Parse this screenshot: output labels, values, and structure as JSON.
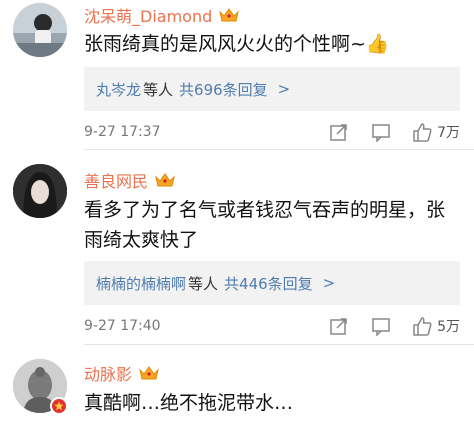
{
  "comments": [
    {
      "username": "沈呆萌_Diamond",
      "text": "张雨绮真的是风风火火的个性啊~👍",
      "reply_names": "丸岑龙",
      "reply_suffix": "等人",
      "reply_count": "共696条回复",
      "reply_arrow": ">",
      "time": "9-27 17:37",
      "likes": "7万",
      "avatar_icon": "avatar-girl-icon"
    },
    {
      "username": "善良网民",
      "text": "看多了为了名气或者钱忍气吞声的明星，张雨绮太爽快了",
      "reply_names": "楠楠的楠楠啊",
      "reply_suffix": "等人",
      "reply_count": "共446条回复",
      "reply_arrow": ">",
      "time": "9-27 17:40",
      "likes": "5万",
      "avatar_icon": "avatar-dark-hair-icon"
    },
    {
      "username": "动脉影",
      "text": "真酷啊…绝不拖泥带水…",
      "avatar_icon": "avatar-statue-icon"
    }
  ],
  "colors": {
    "username": "#eb7350",
    "link": "#507daf",
    "crown": "#f5a623",
    "reply_bg": "#f2f2f2"
  }
}
